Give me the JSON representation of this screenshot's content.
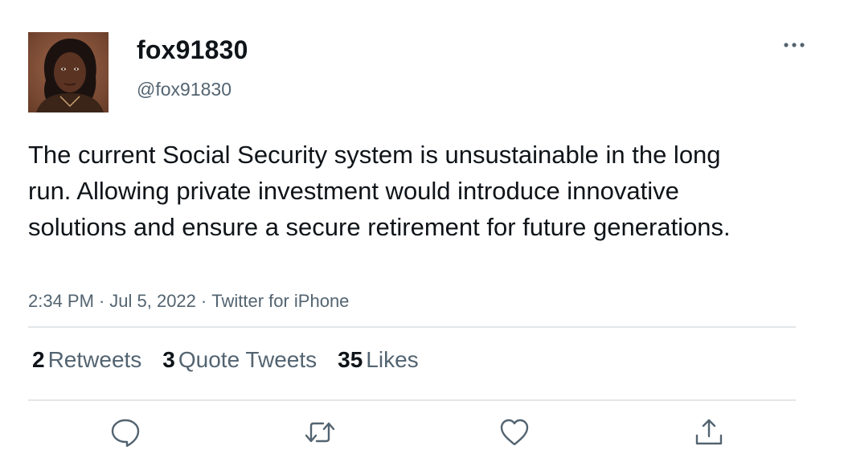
{
  "user": {
    "display_name": "fox91830",
    "handle": "@fox91830"
  },
  "tweet": {
    "text": "The current Social Security system is unsustainable in the long run. Allowing private investment would introduce innovative solutions and ensure a secure retirement for future generations.",
    "time": "2:34 PM",
    "date": "Jul 5, 2022",
    "source": "Twitter for iPhone",
    "separator": "·"
  },
  "stats": {
    "retweets_count": "2",
    "retweets_label": "Retweets",
    "quotes_count": "3",
    "quotes_label": "Quote Tweets",
    "likes_count": "35",
    "likes_label": "Likes"
  },
  "actions": [
    {
      "icon": "reply-icon"
    },
    {
      "icon": "retweet-icon"
    },
    {
      "icon": "like-icon"
    },
    {
      "icon": "share-icon"
    }
  ],
  "colors": {
    "text": "#0f1419",
    "secondary": "#536471",
    "divider": "#e3e6e8"
  }
}
